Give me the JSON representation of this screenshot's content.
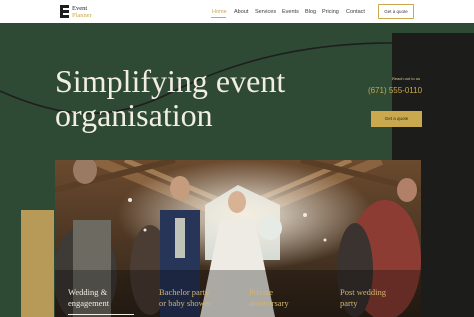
{
  "brand": {
    "line1": "Event",
    "line2": "Planner"
  },
  "nav": {
    "items": [
      {
        "label": "Home",
        "active": true
      },
      {
        "label": "About",
        "active": false
      },
      {
        "label": "Services",
        "active": false
      },
      {
        "label": "Events",
        "active": false
      },
      {
        "label": "Blog",
        "active": false
      },
      {
        "label": "Pricing",
        "active": false
      },
      {
        "label": "Contact",
        "active": false
      }
    ],
    "cta": "Get a quote"
  },
  "hero": {
    "title_line1": "Simplifying event",
    "title_line2": "organisation",
    "reach_label": "Reach out to us",
    "phone": "(671) 555-0110",
    "cta": "Get a quote"
  },
  "services": [
    {
      "line1": "Wedding &",
      "line2": "engagement"
    },
    {
      "line1": "Bachelor party",
      "line2": "or baby shower"
    },
    {
      "line1": "Private",
      "line2": "anniversary"
    },
    {
      "line1": "Post wedding",
      "line2": "party"
    }
  ],
  "colors": {
    "hero_bg": "#2e4a35",
    "accent_gold": "#c9a84e",
    "dark_panel": "#1c1d1b",
    "text_light": "#f2eee4"
  }
}
